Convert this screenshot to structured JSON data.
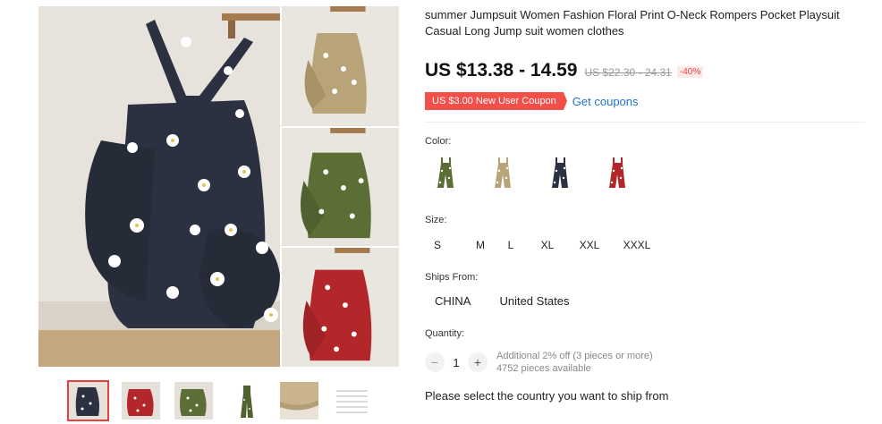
{
  "colors": {
    "price": "#111111",
    "discount": "#e64340",
    "coupon_bg": "#f24e4a",
    "link": "#2273c9"
  },
  "gallery": {
    "main_image": "floral-overalls-black",
    "side_images": [
      "floral-overalls-khaki",
      "floral-overalls-green",
      "floral-overalls-red"
    ],
    "thumbnails": [
      "thumb-black",
      "thumb-red",
      "thumb-green",
      "thumb-green-flat",
      "thumb-khaki-detail",
      "thumb-size-chart"
    ]
  },
  "product": {
    "title": "summer Jumpsuit Women Fashion Floral Print O-Neck Rompers Pocket Playsuit Casual Long Jump suit women clothes",
    "price": "US $13.38 - 14.59",
    "original_price": "US $22.30 - 24.31",
    "discount": "-40%",
    "coupon": "US $3.00 New User Coupon",
    "get_coupons": "Get coupons"
  },
  "options": {
    "color_label": "Color:",
    "colors": [
      "army green",
      "khaki",
      "navy",
      "red"
    ],
    "size_label": "Size:",
    "sizes": [
      "S",
      "M",
      "L",
      "XL",
      "XXL",
      "XXXL"
    ],
    "ships_label": "Ships From:",
    "ships_from": [
      "CHINA",
      "United States"
    ],
    "quantity_label": "Quantity:",
    "quantity": "1",
    "qty_minus": "−",
    "qty_plus": "+",
    "bulk_offer": "Additional 2% off (3 pieces or more)",
    "available": "4752 pieces available"
  },
  "ship_message": "Please select the country you want to ship from"
}
